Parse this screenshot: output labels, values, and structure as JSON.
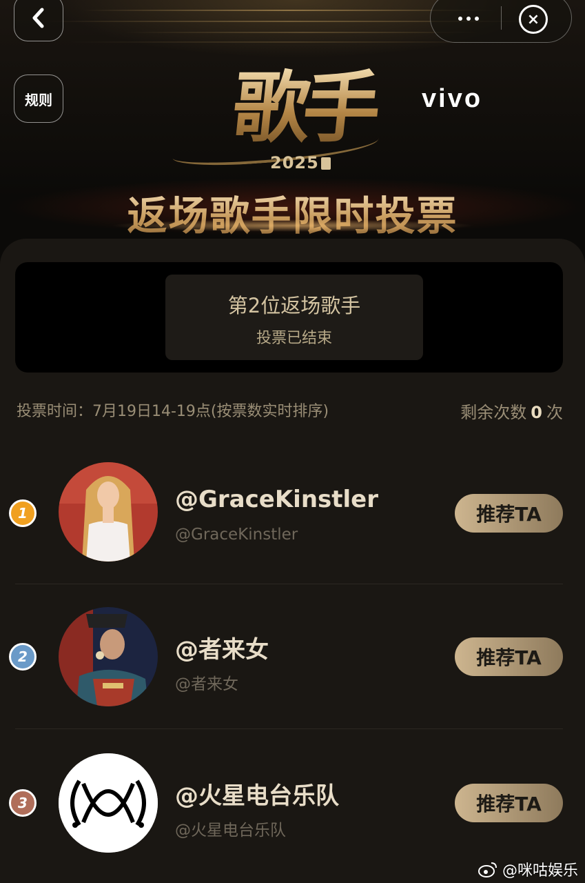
{
  "header": {
    "rules_label": "规则",
    "logo_text": "歌手",
    "logo_year": "2025",
    "brand": "vivo",
    "title": "返场歌手限时投票"
  },
  "status": {
    "title": "第2位返场歌手",
    "subtitle": "投票已结束"
  },
  "vote_info": "投票时间：7月19日14-19点(按票数实时排序)",
  "remaining": {
    "prefix": "剩余次数",
    "count": "0",
    "suffix": "次"
  },
  "candidates": [
    {
      "rank": "1",
      "name": "@GraceKinstler",
      "handle": "@GraceKinstler",
      "button": "推荐TA",
      "badge_color": "#f0a020"
    },
    {
      "rank": "2",
      "name": "@者来女",
      "handle": "@者来女",
      "button": "推荐TA",
      "badge_color": "#6a9ac8"
    },
    {
      "rank": "3",
      "name": "@火星电台乐队",
      "handle": "@火星电台乐队",
      "button": "推荐TA",
      "badge_color": "#b06e5a"
    }
  ],
  "watermark": "@咪咕娱乐",
  "icons": {
    "back": "chevron-left-icon",
    "more": "more-dots-icon",
    "close": "close-circle-icon",
    "weibo": "weibo-logo-icon"
  }
}
